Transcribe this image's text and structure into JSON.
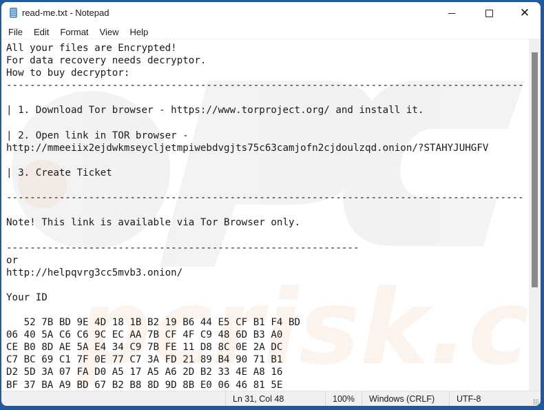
{
  "window": {
    "title": "read-me.txt - Notepad",
    "app_icon": "notepad-icon",
    "controls": {
      "minimize": "minimize-icon",
      "maximize": "maximize-icon",
      "close": "close-icon",
      "close_glyph": "✕"
    }
  },
  "menu": {
    "items": [
      {
        "label": "File"
      },
      {
        "label": "Edit"
      },
      {
        "label": "Format"
      },
      {
        "label": "View"
      },
      {
        "label": "Help"
      }
    ]
  },
  "document": {
    "lines": [
      "All your files are Encrypted!",
      "For data recovery needs decryptor.",
      "How to buy decryptor:",
      "----------------------------------------------------------------------------------------",
      "",
      "| 1. Download Tor browser - https://www.torproject.org/ and install it.",
      "",
      "| 2. Open link in TOR browser -",
      "http://mmeeiix2ejdwkmseycljetmpiwebdvgjts75c63camjofn2cjdoulzqd.onion/?STAHYJUHGFV",
      "",
      "| 3. Create Ticket",
      "",
      "----------------------------------------------------------------------------------------",
      "",
      "Note! This link is available via Tor Browser only.",
      "",
      "------------------------------------------------------------",
      "or",
      "http://helpqvrg3cc5mvb3.onion/",
      "",
      "Your ID",
      "",
      "   52 7B BD 9E 4D 18 1B B2 19 B6 44 E5 CF B1 F4 BD",
      "06 40 5A C6 C6 9C EC AA 7B CF 4F C9 48 6D B3 A0",
      "CE B0 8D AE 5A E4 34 C9 7B FE 11 D8 8C 0E 2A DC",
      "C7 BC 69 C1 7F 0E 77 C7 3A FD 21 89 B4 90 71 B1",
      "D2 5D 3A 07 FA D0 A5 17 A5 A6 2D B2 33 4E A8 16",
      "BF 37 BA A9 BD 67 B2 B8 8D 9D 8B E0 06 46 81 5E"
    ]
  },
  "statusbar": {
    "position": "Ln 31, Col 48",
    "zoom": "100%",
    "line_ending": "Windows (CRLF)",
    "encoding": "UTF-8"
  },
  "colors": {
    "desktop_accent": "#1f5aa0",
    "status_background": "#f0f0f0",
    "scroll_thumb": "#8a8a8a"
  },
  "watermark": {
    "text": "pcrisk.com"
  }
}
